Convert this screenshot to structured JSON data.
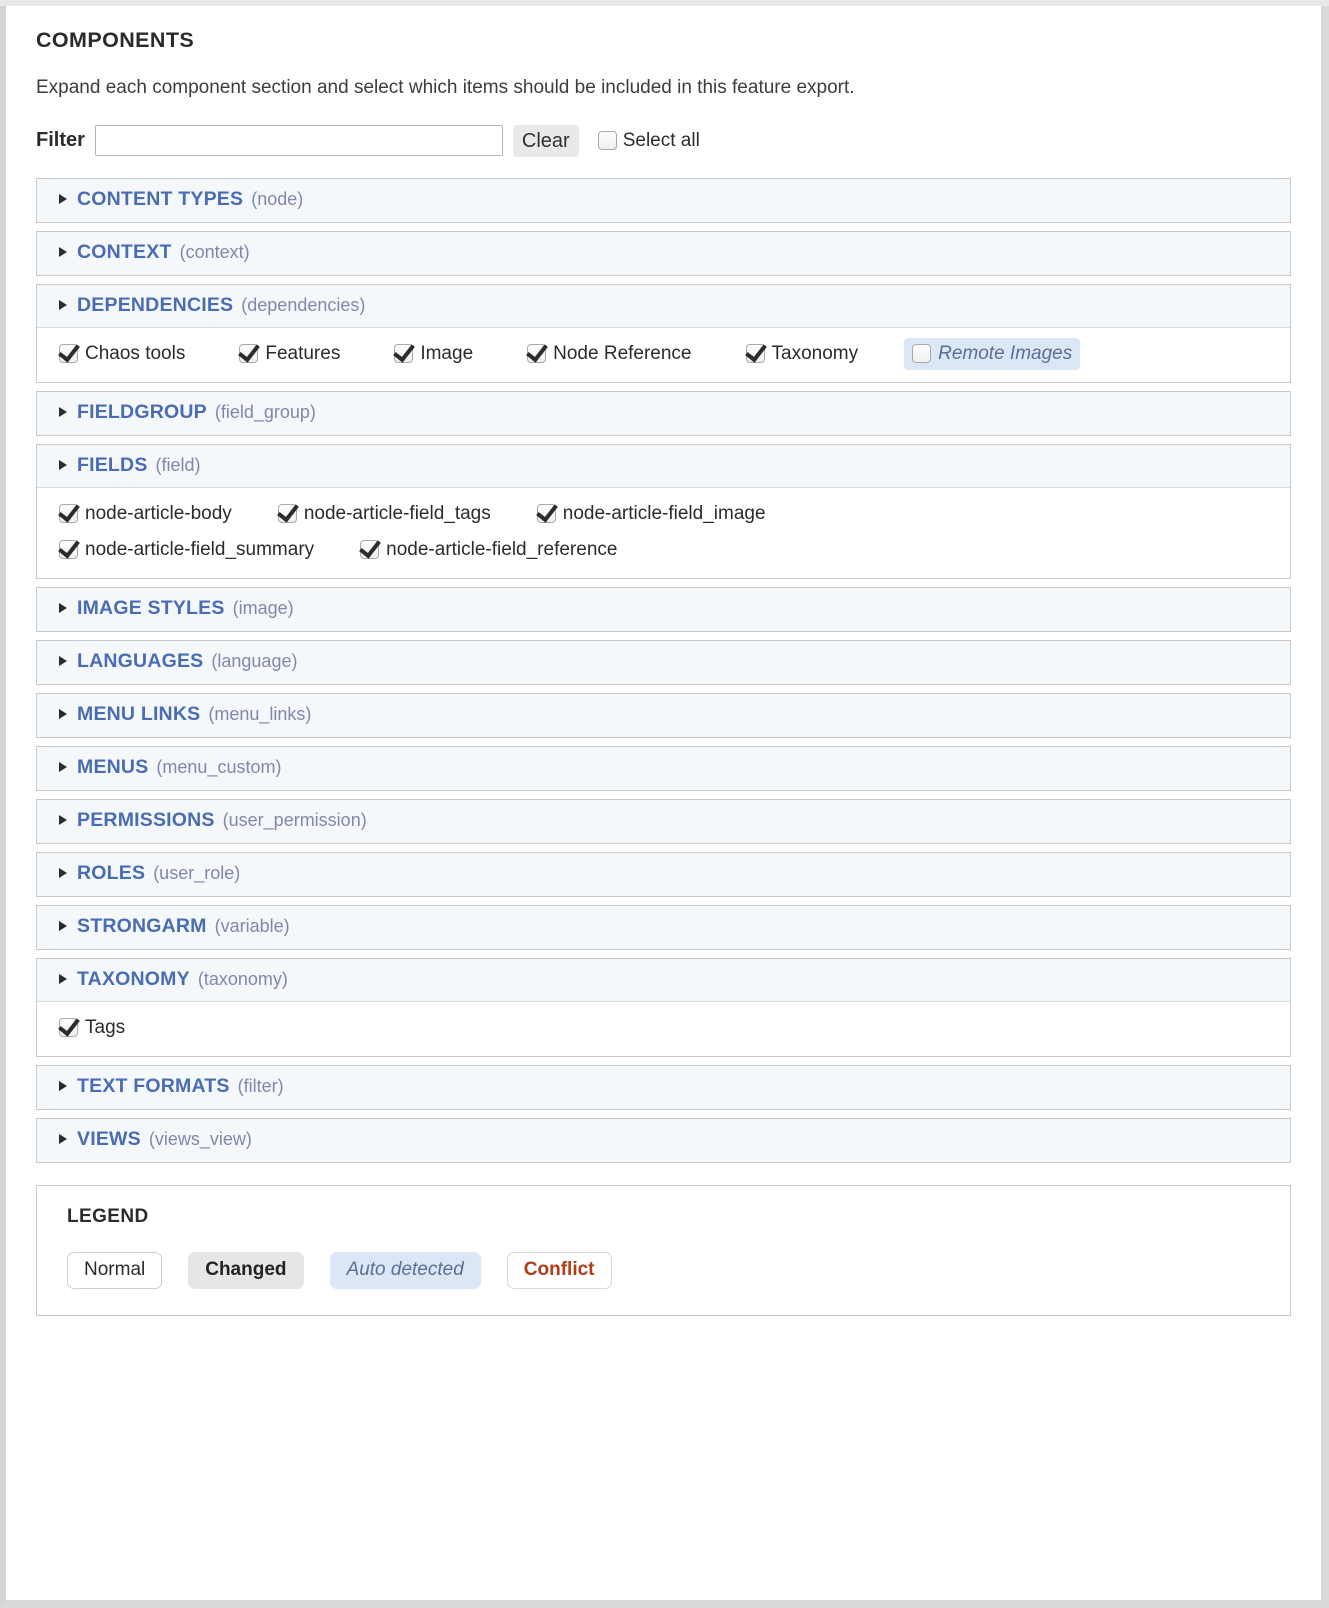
{
  "panel": {
    "title": "COMPONENTS",
    "intro": "Expand each component section and select which items should be included in this feature export."
  },
  "filter": {
    "label": "Filter",
    "value": "",
    "placeholder": "",
    "clear_label": "Clear",
    "select_all_label": "Select all",
    "select_all_checked": false
  },
  "sections": [
    {
      "name": "CONTENT TYPES",
      "machine": "(node)",
      "expanded": false,
      "items": []
    },
    {
      "name": "CONTEXT",
      "machine": "(context)",
      "expanded": false,
      "items": []
    },
    {
      "name": "DEPENDENCIES",
      "machine": "(dependencies)",
      "expanded": true,
      "items": [
        {
          "label": "Chaos tools",
          "checked": true,
          "state": "normal"
        },
        {
          "label": "Features",
          "checked": true,
          "state": "normal"
        },
        {
          "label": "Image",
          "checked": true,
          "state": "normal"
        },
        {
          "label": "Node Reference",
          "checked": true,
          "state": "normal"
        },
        {
          "label": "Taxonomy",
          "checked": true,
          "state": "normal"
        },
        {
          "label": "Remote Images",
          "checked": false,
          "state": "auto"
        }
      ]
    },
    {
      "name": "FIELDGROUP",
      "machine": "(field_group)",
      "expanded": false,
      "items": []
    },
    {
      "name": "FIELDS",
      "machine": "(field)",
      "expanded": true,
      "items": [
        {
          "label": "node-article-body",
          "checked": true,
          "state": "normal"
        },
        {
          "label": "node-article-field_tags",
          "checked": true,
          "state": "normal"
        },
        {
          "label": "node-article-field_image",
          "checked": true,
          "state": "normal"
        },
        {
          "label": "node-article-field_summary",
          "checked": true,
          "state": "normal"
        },
        {
          "label": "node-article-field_reference",
          "checked": true,
          "state": "normal"
        }
      ]
    },
    {
      "name": "IMAGE STYLES",
      "machine": "(image)",
      "expanded": false,
      "items": []
    },
    {
      "name": "LANGUAGES",
      "machine": "(language)",
      "expanded": false,
      "items": []
    },
    {
      "name": "MENU LINKS",
      "machine": "(menu_links)",
      "expanded": false,
      "items": []
    },
    {
      "name": "MENUS",
      "machine": "(menu_custom)",
      "expanded": false,
      "items": []
    },
    {
      "name": "PERMISSIONS",
      "machine": "(user_permission)",
      "expanded": false,
      "items": []
    },
    {
      "name": "ROLES",
      "machine": "(user_role)",
      "expanded": false,
      "items": []
    },
    {
      "name": "STRONGARM",
      "machine": "(variable)",
      "expanded": false,
      "items": []
    },
    {
      "name": "TAXONOMY",
      "machine": "(taxonomy)",
      "expanded": true,
      "items": [
        {
          "label": "Tags",
          "checked": true,
          "state": "normal"
        }
      ]
    },
    {
      "name": "TEXT FORMATS",
      "machine": "(filter)",
      "expanded": false,
      "items": []
    },
    {
      "name": "VIEWS",
      "machine": "(views_view)",
      "expanded": false,
      "items": []
    }
  ],
  "legend": {
    "title": "LEGEND",
    "badges": [
      {
        "label": "Normal",
        "state": "normal"
      },
      {
        "label": "Changed",
        "state": "changed"
      },
      {
        "label": "Auto detected",
        "state": "autodetected"
      },
      {
        "label": "Conflict",
        "state": "conflict"
      }
    ]
  },
  "colors": {
    "section_header_label": "#4a6cb3",
    "section_header_machine": "#7f87ad",
    "section_header_bg": "#f4f8fb",
    "auto_detected_bg": "#dbe7f7",
    "auto_detected_text": "#5d6e92",
    "changed_bg": "#e6e6e6",
    "conflict_text": "#b03c18",
    "border": "#c9c9c9"
  }
}
